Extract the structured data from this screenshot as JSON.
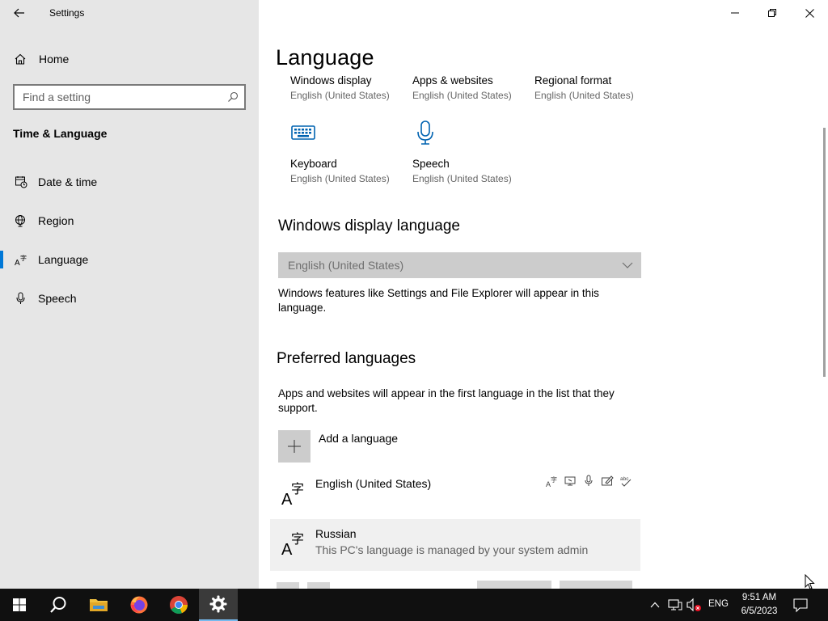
{
  "window": {
    "title": "Settings",
    "controls": [
      "minimize-icon",
      "restore-icon",
      "close-icon"
    ]
  },
  "sidebar": {
    "home_label": "Home",
    "search_placeholder": "Find a setting",
    "section_title": "Time & Language",
    "items": [
      {
        "label": "Date & time",
        "icon": "calendar-clock-icon",
        "active": false
      },
      {
        "label": "Region",
        "icon": "globe-icon",
        "active": false
      },
      {
        "label": "Language",
        "icon": "language-icon",
        "active": true
      },
      {
        "label": "Speech",
        "icon": "microphone-icon",
        "active": false
      }
    ]
  },
  "main": {
    "page_title": "Language",
    "tiles_row1": [
      {
        "name": "Windows display",
        "sub": "English (United States)"
      },
      {
        "name": "Apps & websites",
        "sub": "English (United States)"
      },
      {
        "name": "Regional format",
        "sub": "English (United States)"
      }
    ],
    "tiles_row2": [
      {
        "name": "Keyboard",
        "sub": "English (United States)",
        "icon": "keyboard-icon"
      },
      {
        "name": "Speech",
        "sub": "English (United States)",
        "icon": "microphone-icon"
      }
    ],
    "display_language": {
      "heading": "Windows display language",
      "selected": "English (United States)",
      "description": "Windows features like Settings and File Explorer will appear in this language."
    },
    "preferred": {
      "heading": "Preferred languages",
      "description": "Apps and websites will appear in the first language in the list that they support.",
      "add_label": "Add a language",
      "languages": [
        {
          "name": "English (United States)",
          "sub": "",
          "features": [
            "display-language-icon",
            "text-to-speech-icon",
            "speech-icon",
            "handwriting-icon",
            "spellcheck-icon"
          ]
        },
        {
          "name": "Russian",
          "sub": "This PC's language is managed by your system admin"
        }
      ]
    }
  },
  "taskbar": {
    "apps": [
      "windows-start-icon",
      "search-icon",
      "file-explorer-icon",
      "firefox-icon",
      "chrome-icon",
      "settings-icon"
    ],
    "active_app": "settings-icon",
    "language": "ENG",
    "time": "9:51 AM",
    "date": "6/5/2023"
  },
  "colors": {
    "sidebar_bg": "#e6e6e6",
    "accent": "#0078d7",
    "taskbar_bg": "#101010"
  }
}
